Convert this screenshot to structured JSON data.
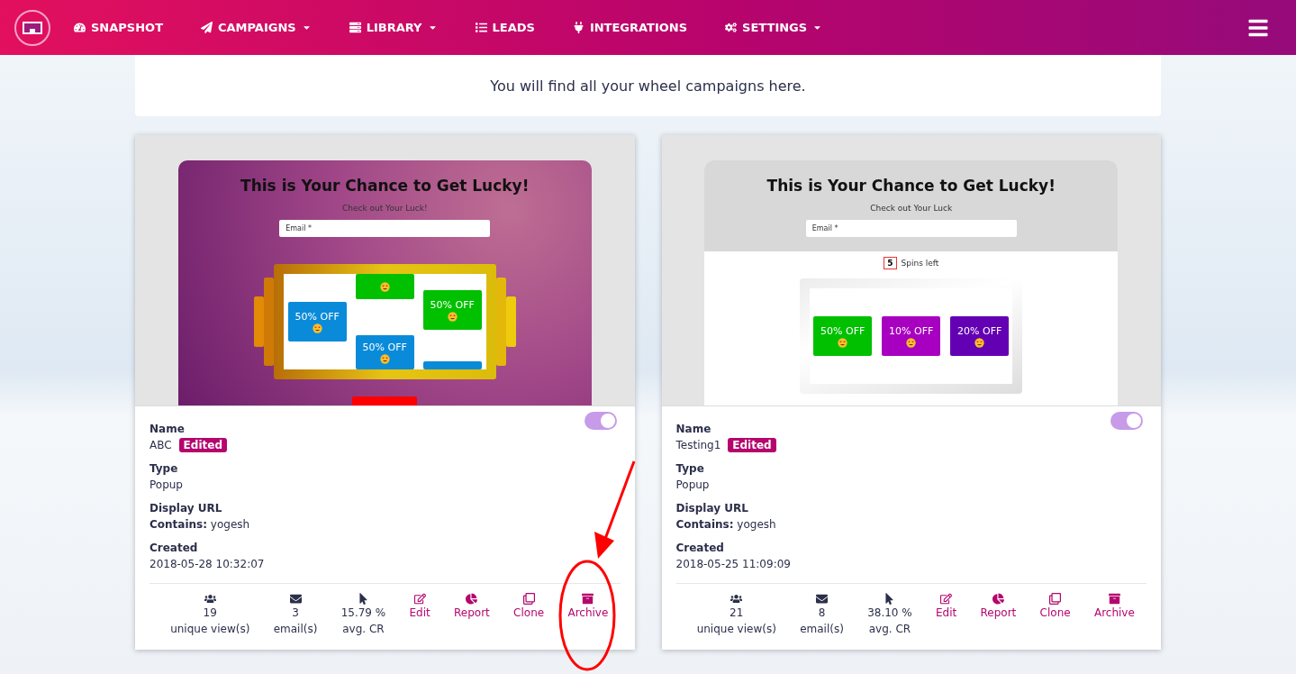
{
  "nav": {
    "items": [
      {
        "label": "SNAPSHOT",
        "dropdown": false
      },
      {
        "label": "CAMPAIGNS",
        "dropdown": true
      },
      {
        "label": "LIBRARY",
        "dropdown": true
      },
      {
        "label": "LEADS",
        "dropdown": false
      },
      {
        "label": "INTEGRATIONS",
        "dropdown": false
      },
      {
        "label": "SETTINGS",
        "dropdown": true
      }
    ]
  },
  "banner": {
    "text": "You will find all your wheel campaigns here."
  },
  "campaigns": [
    {
      "preview": {
        "kind": "slot",
        "title": "This is Your Chance to Get Lucky!",
        "subtitle": "Check out Your Luck!",
        "email_placeholder": "Email *",
        "tiles": [
          {
            "label": "50% OFF",
            "color": "#0a8bd9"
          },
          {
            "color": "#00c000"
          },
          {
            "label": "50% OFF",
            "color": "#00c000"
          },
          {
            "label": "50% OFF",
            "color": "#0a8bd9"
          },
          {
            "color": "#0a8bd9"
          }
        ]
      },
      "on": true,
      "name_label": "Name",
      "name": "ABC",
      "badge": "Edited",
      "type_label": "Type",
      "type": "Popup",
      "url_label": "Display URL",
      "url_prefix": "Contains:",
      "url_value": "yogesh",
      "created_label": "Created",
      "created": "2018-05-28 10:32:07",
      "stats": [
        {
          "kind": "stat",
          "value": "19",
          "label": "unique view(s)"
        },
        {
          "kind": "stat",
          "value": "3",
          "label": "email(s)"
        },
        {
          "kind": "stat",
          "value": "15.79 %",
          "label": "avg. CR"
        },
        {
          "kind": "action",
          "label": "Edit"
        },
        {
          "kind": "action",
          "label": "Report"
        },
        {
          "kind": "action",
          "label": "Clone"
        },
        {
          "kind": "action",
          "label": "Archive"
        }
      ]
    },
    {
      "preview": {
        "kind": "row",
        "title": "This is Your Chance to Get Lucky!",
        "subtitle": "Check out Your Luck",
        "email_placeholder": "Email *",
        "spins": "5",
        "spins_label": "Spins left",
        "tiles": [
          {
            "label": "50% OFF",
            "color": "#00c000"
          },
          {
            "label": "10% OFF",
            "color": "#a800c0"
          },
          {
            "label": "20% OFF",
            "color": "#6400b4"
          }
        ]
      },
      "on": true,
      "name_label": "Name",
      "name": "Testing1",
      "badge": "Edited",
      "type_label": "Type",
      "type": "Popup",
      "url_label": "Display URL",
      "url_prefix": "Contains:",
      "url_value": "yogesh",
      "created_label": "Created",
      "created": "2018-05-25 11:09:09",
      "stats": [
        {
          "kind": "stat",
          "value": "21",
          "label": "unique view(s)"
        },
        {
          "kind": "stat",
          "value": "8",
          "label": "email(s)"
        },
        {
          "kind": "stat",
          "value": "38.10 %",
          "label": "avg. CR"
        },
        {
          "kind": "action",
          "label": "Edit"
        },
        {
          "kind": "action",
          "label": "Report"
        },
        {
          "kind": "action",
          "label": "Clone"
        },
        {
          "kind": "action",
          "label": "Archive"
        }
      ]
    }
  ]
}
